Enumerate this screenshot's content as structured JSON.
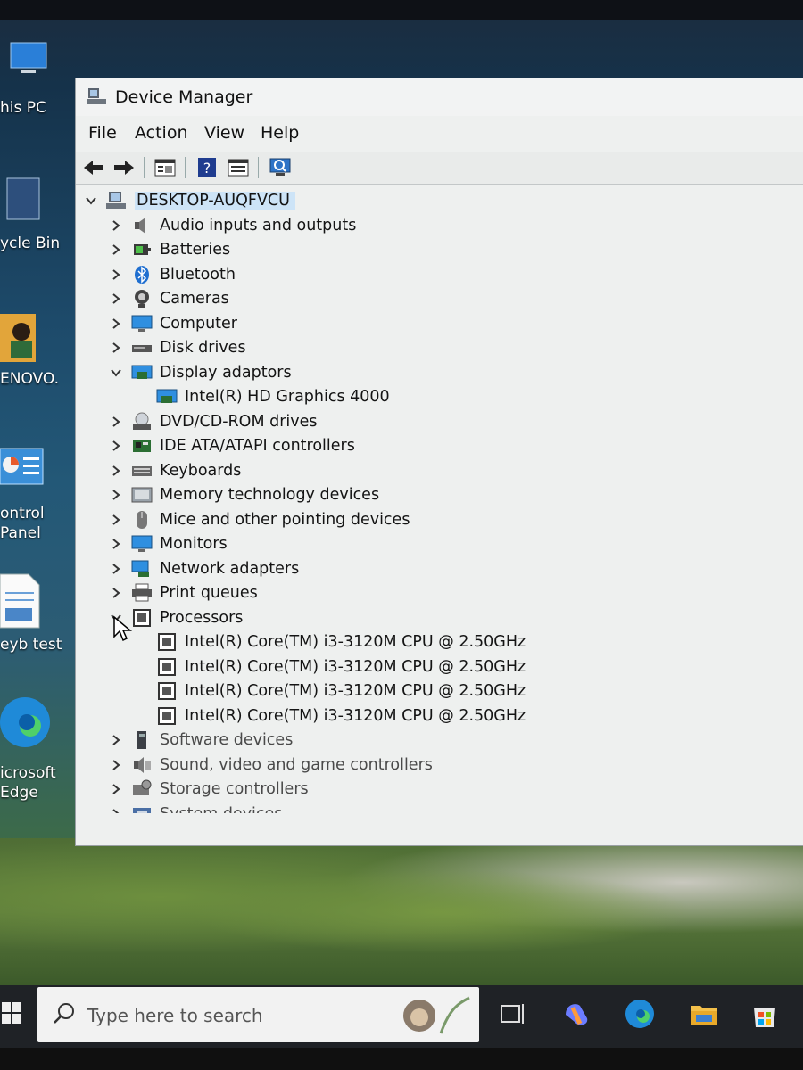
{
  "window": {
    "title": "Device Manager"
  },
  "menu": [
    "File",
    "Action",
    "View",
    "Help"
  ],
  "tree": {
    "root": "DESKTOP-AUQFVCU",
    "items": [
      {
        "label": "Audio inputs and outputs",
        "icon": "speaker-icon",
        "expanded": false
      },
      {
        "label": "Batteries",
        "icon": "battery-icon",
        "expanded": false
      },
      {
        "label": "Bluetooth",
        "icon": "bluetooth-icon",
        "expanded": false
      },
      {
        "label": "Cameras",
        "icon": "camera-icon",
        "expanded": false
      },
      {
        "label": "Computer",
        "icon": "monitor-icon",
        "expanded": false
      },
      {
        "label": "Disk drives",
        "icon": "disk-drive-icon",
        "expanded": false
      },
      {
        "label": "Display adaptors",
        "icon": "display-adapter-icon",
        "expanded": true,
        "children": [
          "Intel(R) HD Graphics 4000"
        ]
      },
      {
        "label": "DVD/CD-ROM drives",
        "icon": "optical-drive-icon",
        "expanded": false
      },
      {
        "label": "IDE ATA/ATAPI controllers",
        "icon": "ide-controller-icon",
        "expanded": false
      },
      {
        "label": "Keyboards",
        "icon": "keyboard-icon",
        "expanded": false
      },
      {
        "label": "Memory technology devices",
        "icon": "memory-device-icon",
        "expanded": false
      },
      {
        "label": "Mice and other pointing devices",
        "icon": "mouse-icon",
        "expanded": false
      },
      {
        "label": "Monitors",
        "icon": "monitor-icon",
        "expanded": false
      },
      {
        "label": "Network adapters",
        "icon": "network-adapter-icon",
        "expanded": false
      },
      {
        "label": "Print queues",
        "icon": "printer-icon",
        "expanded": false
      },
      {
        "label": "Processors",
        "icon": "processor-icon",
        "expanded": true,
        "children": [
          "Intel(R) Core(TM) i3-3120M CPU @ 2.50GHz",
          "Intel(R) Core(TM) i3-3120M CPU @ 2.50GHz",
          "Intel(R) Core(TM) i3-3120M CPU @ 2.50GHz",
          "Intel(R) Core(TM) i3-3120M CPU @ 2.50GHz"
        ]
      },
      {
        "label": "Software devices",
        "icon": "software-device-icon",
        "expanded": false
      },
      {
        "label": "Sound, video and game controllers",
        "icon": "sound-controller-icon",
        "expanded": false
      },
      {
        "label": "Storage controllers",
        "icon": "storage-controller-icon",
        "expanded": false
      },
      {
        "label": "System devices",
        "icon": "system-device-icon",
        "expanded": false
      }
    ]
  },
  "desktop_icons": [
    {
      "label": "his PC"
    },
    {
      "label": "ycle Bin"
    },
    {
      "label": "ENOVO."
    },
    {
      "label": "ontrol\nPanel"
    },
    {
      "label": "eyb test"
    },
    {
      "label": "icrosoft\nEdge"
    }
  ],
  "taskbar": {
    "search_placeholder": "Type here to search"
  },
  "colors": {
    "selection": "#cde4f7",
    "window_bg": "#eef0ef",
    "taskbar": "#1f2226"
  }
}
